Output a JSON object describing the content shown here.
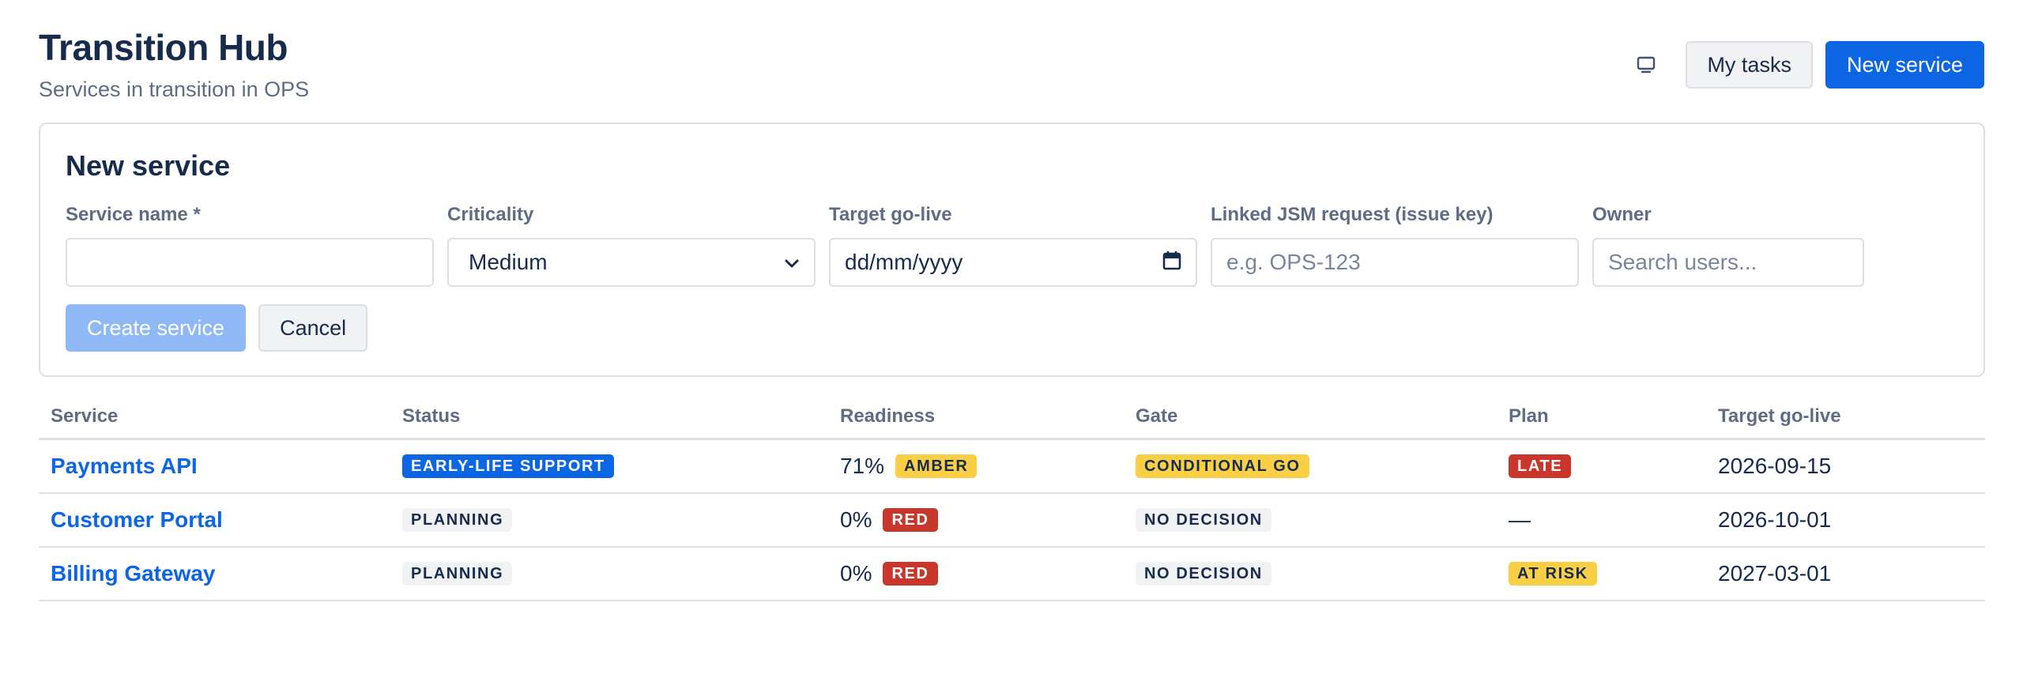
{
  "header": {
    "title": "Transition Hub",
    "subtitle": "Services in transition in OPS",
    "display_icon": "monitor-icon",
    "my_tasks_label": "My tasks",
    "new_service_label": "New service"
  },
  "form": {
    "title": "New service",
    "fields": {
      "service_name": {
        "label": "Service name *",
        "value": ""
      },
      "criticality": {
        "label": "Criticality",
        "value": "Medium"
      },
      "target_go_live": {
        "label": "Target go-live",
        "value": "dd/mm/yyyy"
      },
      "linked_request": {
        "label": "Linked JSM request (issue key)",
        "placeholder": "e.g. OPS-123"
      },
      "owner": {
        "label": "Owner",
        "placeholder": "Search users..."
      }
    },
    "create_label": "Create service",
    "cancel_label": "Cancel"
  },
  "table": {
    "columns": [
      "Service",
      "Status",
      "Readiness",
      "Gate",
      "Plan",
      "Target go-live"
    ],
    "rows": [
      {
        "service": "Payments API",
        "status": "EARLY-LIFE SUPPORT",
        "readiness_pct": "71%",
        "readiness_rag": "AMBER",
        "gate": "CONDITIONAL GO",
        "plan": "LATE",
        "target": "2026-09-15"
      },
      {
        "service": "Customer Portal",
        "status": "PLANNING",
        "readiness_pct": "0%",
        "readiness_rag": "RED",
        "gate": "NO DECISION",
        "plan": "—",
        "target": "2026-10-01"
      },
      {
        "service": "Billing Gateway",
        "status": "PLANNING",
        "readiness_pct": "0%",
        "readiness_rag": "RED",
        "gate": "NO DECISION",
        "plan": "AT RISK",
        "target": "2027-03-01"
      }
    ]
  },
  "colors": {
    "primary": "#0C66E4",
    "primary_disabled": "#8FB8F6",
    "amber": "#F8CF45",
    "red": "#C9372C",
    "text": "#172B4D",
    "subtle": "#5E6C84"
  }
}
